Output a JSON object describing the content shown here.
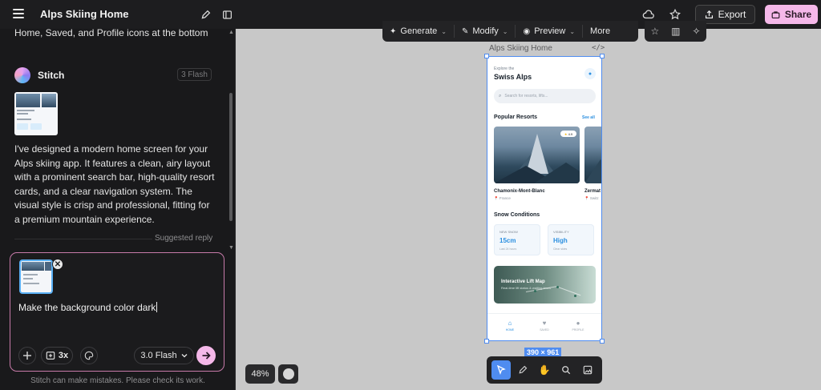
{
  "header": {
    "title": "Alps Skiing Home",
    "export_label": "Export",
    "share_label": "Share"
  },
  "chat": {
    "prev_text_tail": "Home, Saved, and Profile icons at the bottom",
    "assistant_name": "Stitch",
    "model_badge": "3 Flash",
    "message_lines": [
      "I've designed a modern home screen for your",
      "Alps skiing app. It features a clean, airy layout",
      "with a prominent search bar, high-quality resort",
      "cards, and a clear navigation system. The",
      "visual style is crisp and professional, fitting for",
      "a premium mountain experience."
    ],
    "suggested_reply": "Suggested reply",
    "disclaimer": "Stitch can make mistakes. Please check its work."
  },
  "composer": {
    "input_value": "Make the background color dark",
    "variants_label": "3x",
    "model_select": "3.0 Flash"
  },
  "canvas_toolbar": {
    "items": [
      "Generate",
      "Modify",
      "Preview",
      "More"
    ]
  },
  "frame": {
    "label": "Alps Skiing Home",
    "size_label": "390 × 961"
  },
  "phone": {
    "explore_label": "Explore the",
    "title": "Swiss Alps",
    "search_placeholder": "Search for resorts, lifts...",
    "popular_heading": "Popular Resorts",
    "see_all": "See all",
    "rating": "4.9",
    "resorts": [
      {
        "name": "Chamonix-Mont-Blanc",
        "country": "France"
      },
      {
        "name": "Zermat",
        "country": "Switz"
      }
    ],
    "conditions_heading": "Snow Conditions",
    "conditions": [
      {
        "label": "NEW SNOW",
        "value": "15cm",
        "sub": "Last 24 hours"
      },
      {
        "label": "VISIBILITY",
        "value": "High",
        "sub": "Clear skies"
      }
    ],
    "map_title": "Interactive Lift Map",
    "map_subtitle": "Real-time lift status & waiting times",
    "nav": [
      "HOME",
      "SAVED",
      "PROFILE"
    ]
  },
  "zoom": "48%",
  "colors": {
    "accent_blue": "#4f8cf0",
    "share_pink": "#f5b8e9",
    "composer_border": "#c77aa9"
  }
}
